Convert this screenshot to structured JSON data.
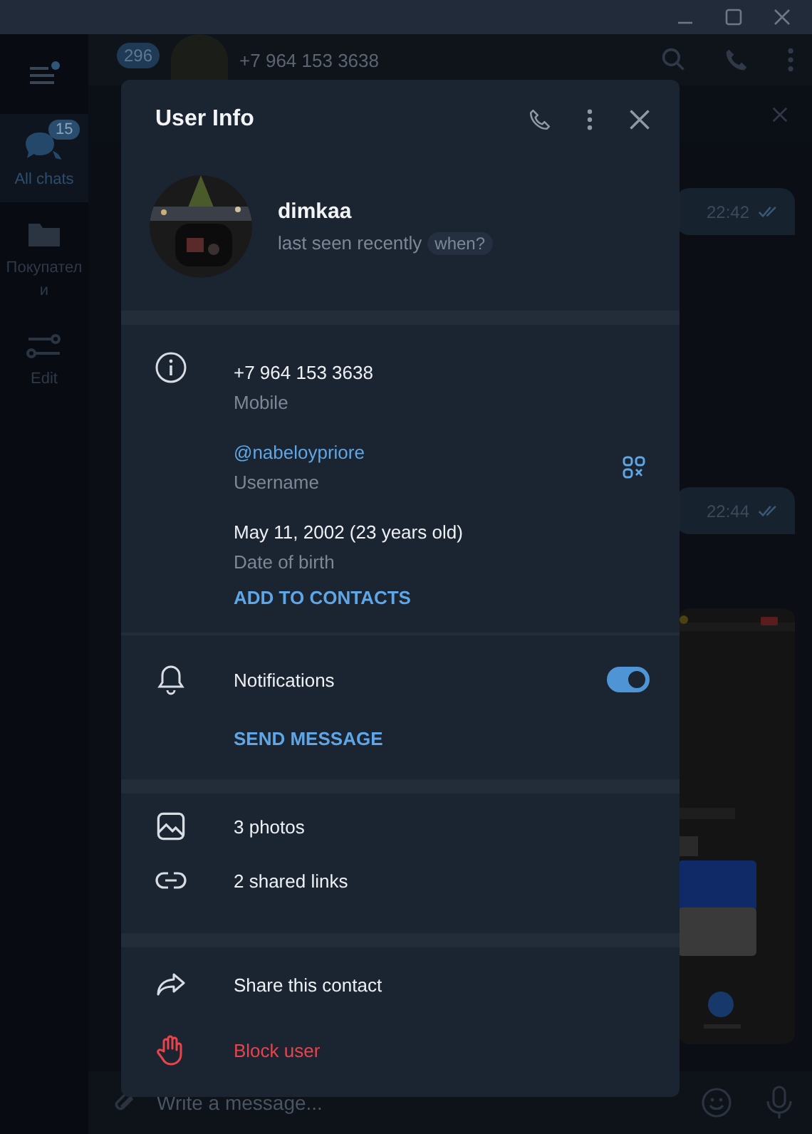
{
  "sidebar": {
    "items": [
      {
        "kind": "chats",
        "label": "All chats",
        "badge": "15",
        "selected": true
      },
      {
        "kind": "folder",
        "label": "Покупатели",
        "selected": false
      },
      {
        "kind": "edit",
        "label": "Edit",
        "selected": false
      }
    ]
  },
  "chat": {
    "unread": "296",
    "title": "+7 964 153 3638",
    "messages": [
      {
        "time": "22:42",
        "read": true
      },
      {
        "time": "22:44",
        "read": true
      }
    ],
    "input": {
      "placeholder": "Write a message..."
    }
  },
  "dialog": {
    "title": "User Info",
    "name": "dimkaa",
    "status": "last seen recently",
    "status_button": "when?",
    "info": [
      {
        "kind": "phone",
        "value": "+7 964 153 3638",
        "label": "Mobile"
      },
      {
        "kind": "username",
        "value": "@nabeloypriore",
        "label": "Username"
      },
      {
        "kind": "birthday",
        "value": "May 11, 2002 (23 years old)",
        "label": "Date of birth"
      }
    ],
    "add_contact": "ADD TO CONTACTS",
    "notifications": {
      "label": "Notifications",
      "on": true
    },
    "send_message": "SEND MESSAGE",
    "media": [
      {
        "kind": "photos",
        "label": "3 photos"
      },
      {
        "kind": "links",
        "label": "2 shared links"
      }
    ],
    "actions": [
      {
        "kind": "share",
        "label": "Share this contact",
        "danger": false
      },
      {
        "kind": "block",
        "label": "Block user",
        "danger": true
      }
    ]
  }
}
